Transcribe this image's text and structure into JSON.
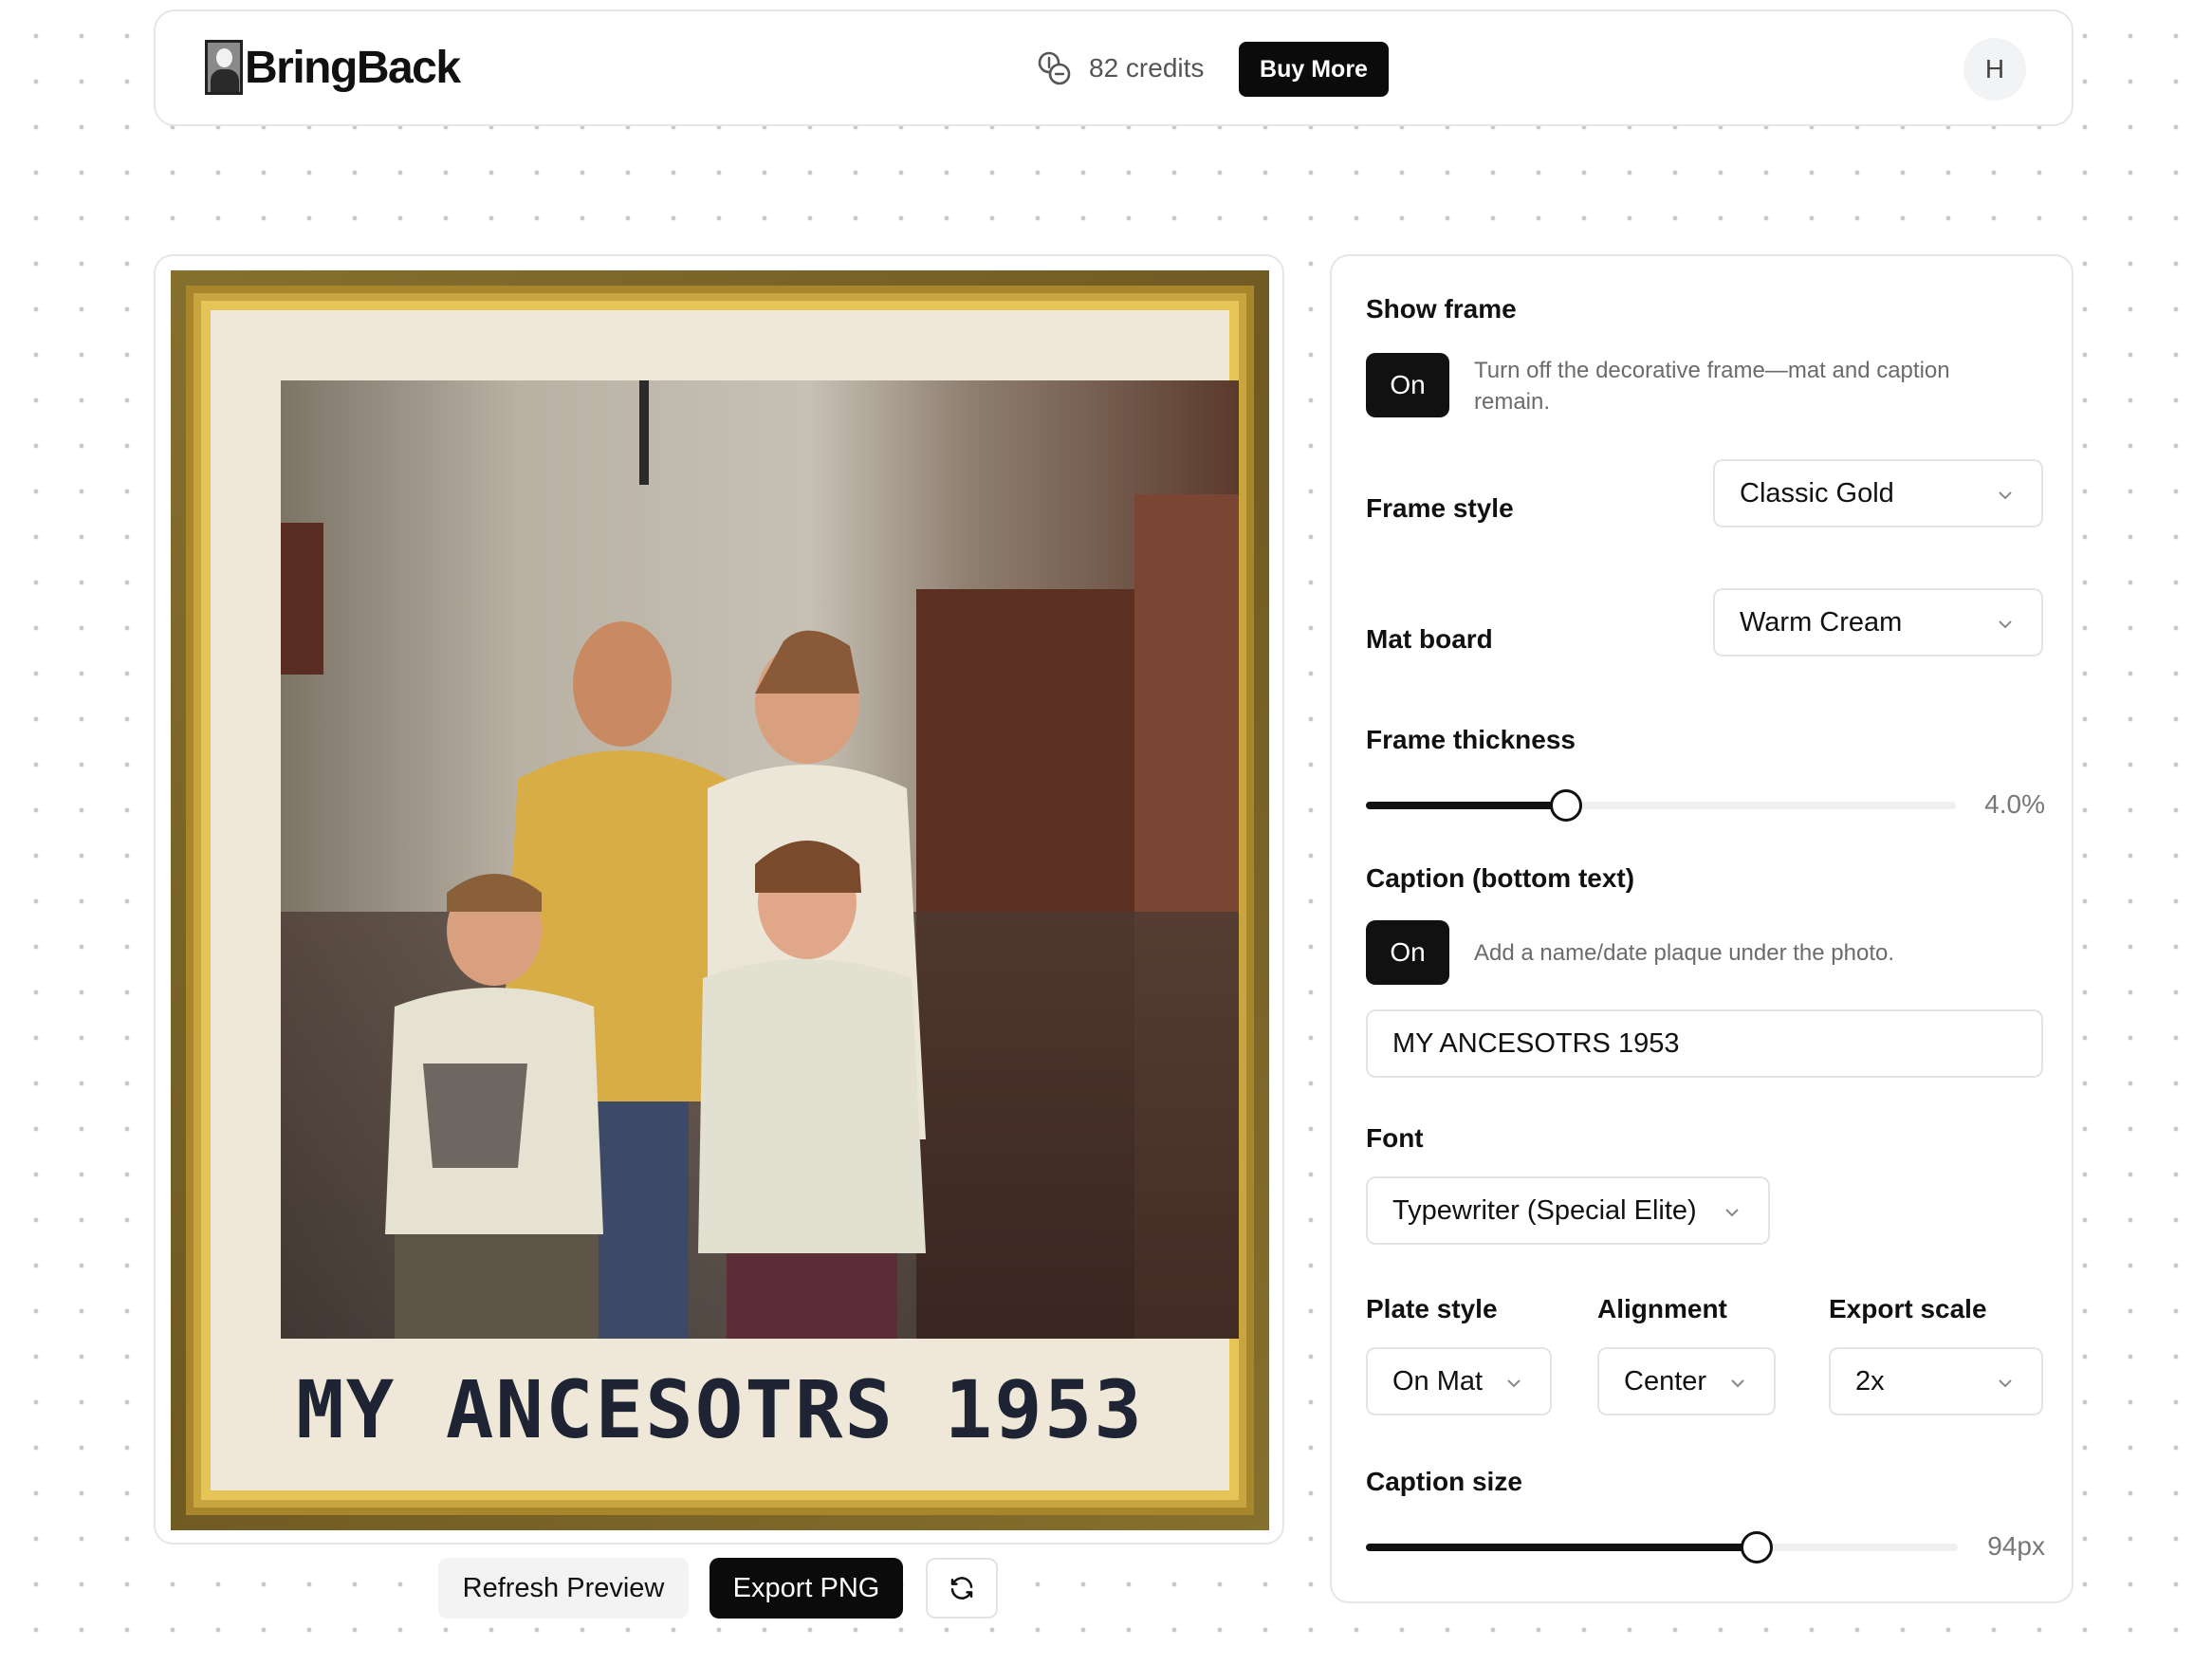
{
  "header": {
    "app_name": "BringBack",
    "credits_text": "82 credits",
    "buy_more_label": "Buy More",
    "avatar_initial": "H"
  },
  "preview": {
    "caption": "MY ANCESOTRS 1953",
    "refresh_label": "Refresh Preview",
    "export_label": "Export PNG"
  },
  "settings": {
    "show_frame": {
      "label": "Show frame",
      "toggle": "On",
      "help": "Turn off the decorative frame—mat and caption remain."
    },
    "frame_style": {
      "label": "Frame style",
      "value": "Classic Gold"
    },
    "mat_board": {
      "label": "Mat board",
      "value": "Warm Cream"
    },
    "frame_thickness": {
      "label": "Frame thickness",
      "value_text": "4.0%",
      "fraction": 0.34
    },
    "caption": {
      "label": "Caption (bottom text)",
      "toggle": "On",
      "help": "Add a name/date plaque under the photo.",
      "value": "MY ANCESOTRS 1953"
    },
    "font": {
      "label": "Font",
      "value": "Typewriter (Special Elite)"
    },
    "plate_style": {
      "label": "Plate style",
      "value": "On Mat"
    },
    "alignment": {
      "label": "Alignment",
      "value": "Center"
    },
    "export_scale": {
      "label": "Export scale",
      "value": "2x"
    },
    "caption_size": {
      "label": "Caption size",
      "value_text": "94px",
      "fraction": 0.66
    }
  },
  "colors": {
    "accent": "#0b0b0b",
    "frame_gold": "#c9a53f",
    "mat_cream": "#efe8d8",
    "caption_ink": "#1e2433"
  },
  "icons": {
    "credits": "coins-icon",
    "dropdown": "chevron-down-icon",
    "sync": "refresh-icon"
  }
}
